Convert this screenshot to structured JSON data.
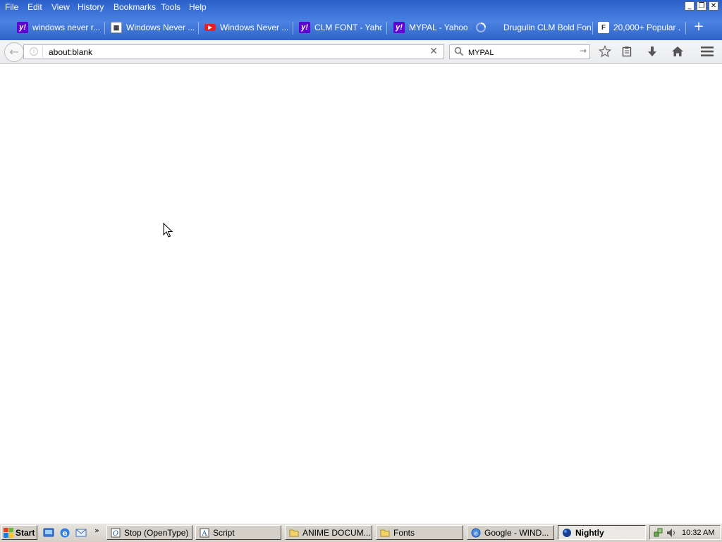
{
  "menu": {
    "items": [
      {
        "label": "File"
      },
      {
        "label": "Edit"
      },
      {
        "label": "View"
      },
      {
        "label": "History"
      },
      {
        "label": "Bookmarks"
      },
      {
        "label": "Tools"
      },
      {
        "label": "Help"
      }
    ]
  },
  "window_controls": {
    "minimize": "_",
    "restore": "❐",
    "close": "✕"
  },
  "tabs": [
    {
      "label": "windows never r...",
      "icon": "yahoo-icon"
    },
    {
      "label": "Windows Never ...",
      "icon": "grid-favicon-icon"
    },
    {
      "label": "Windows Never ...",
      "icon": "youtube-icon"
    },
    {
      "label": "CLM FONT - Yaho...",
      "icon": "yahoo-icon"
    },
    {
      "label": "MYPAL - Yahoo S...",
      "icon": "yahoo-icon",
      "loading": true
    },
    {
      "label": "Drugulin CLM Bold Fon...",
      "icon": "none"
    },
    {
      "label": "20,000+ Popular ...",
      "icon": "font-site-icon"
    }
  ],
  "navbar": {
    "url": "about:blank",
    "search_value": "MYPAL"
  },
  "taskbar": {
    "start_label": "Start",
    "tasks": [
      {
        "label": "Stop (OpenType)",
        "icon": "opentype-icon"
      },
      {
        "label": "Script",
        "icon": "font-icon"
      },
      {
        "label": "ANIME DOCUM...",
        "icon": "folder-icon"
      },
      {
        "label": "Fonts",
        "icon": "folder-icon"
      },
      {
        "label": "Google - WIND...",
        "icon": "browser-icon"
      },
      {
        "label": "Nightly",
        "icon": "nightly-globe-icon",
        "active": true
      }
    ],
    "clock": "10:32 AM"
  },
  "colors": {
    "chrome_blue": "#3d73d8",
    "yahoo_purple": "#5f01d1",
    "youtube_red": "#e62117",
    "taskbar_gray": "#d4d0c8"
  }
}
